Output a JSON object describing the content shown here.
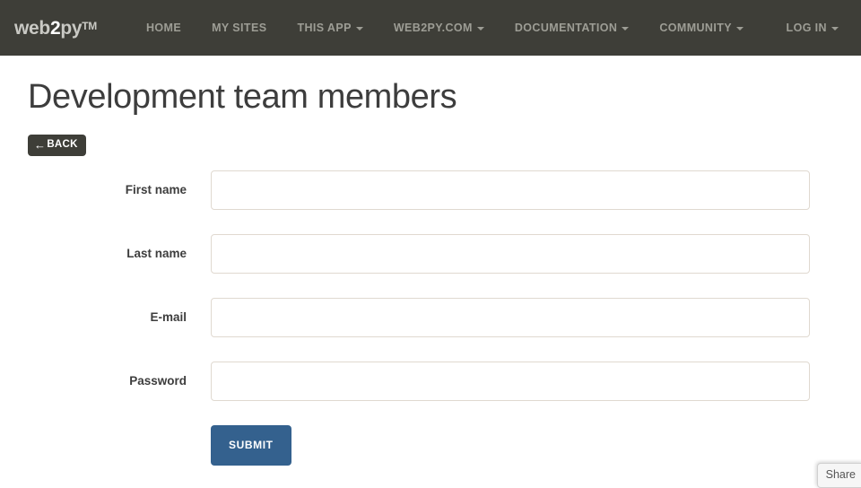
{
  "navbar": {
    "brand": {
      "prefix": "web",
      "two": "2",
      "suffix": "py",
      "tm": "TM"
    },
    "items": [
      {
        "label": "HOME",
        "caret": false
      },
      {
        "label": "MY SITES",
        "caret": false
      },
      {
        "label": "THIS APP",
        "caret": true
      },
      {
        "label": "WEB2PY.COM",
        "caret": true
      },
      {
        "label": "DOCUMENTATION",
        "caret": true
      },
      {
        "label": "COMMUNITY",
        "caret": true
      }
    ],
    "right": {
      "label": "LOG IN",
      "caret": true
    }
  },
  "page": {
    "title": "Development team members",
    "back_label": "BACK",
    "back_arrow": "←"
  },
  "form": {
    "fields": [
      {
        "label": "First name",
        "value": "",
        "placeholder": ""
      },
      {
        "label": "Last name",
        "value": "",
        "placeholder": ""
      },
      {
        "label": "E-mail",
        "value": "",
        "placeholder": ""
      },
      {
        "label": "Password",
        "value": "",
        "placeholder": ""
      }
    ],
    "submit_label": "SUBMIT"
  },
  "share": {
    "label": "Share"
  },
  "colors": {
    "navbar_bg": "#3e3e38",
    "nav_text": "#9d9d95",
    "submit_bg": "#34618e",
    "input_border": "#e0d9d0",
    "title_text": "#3d3d3d"
  }
}
